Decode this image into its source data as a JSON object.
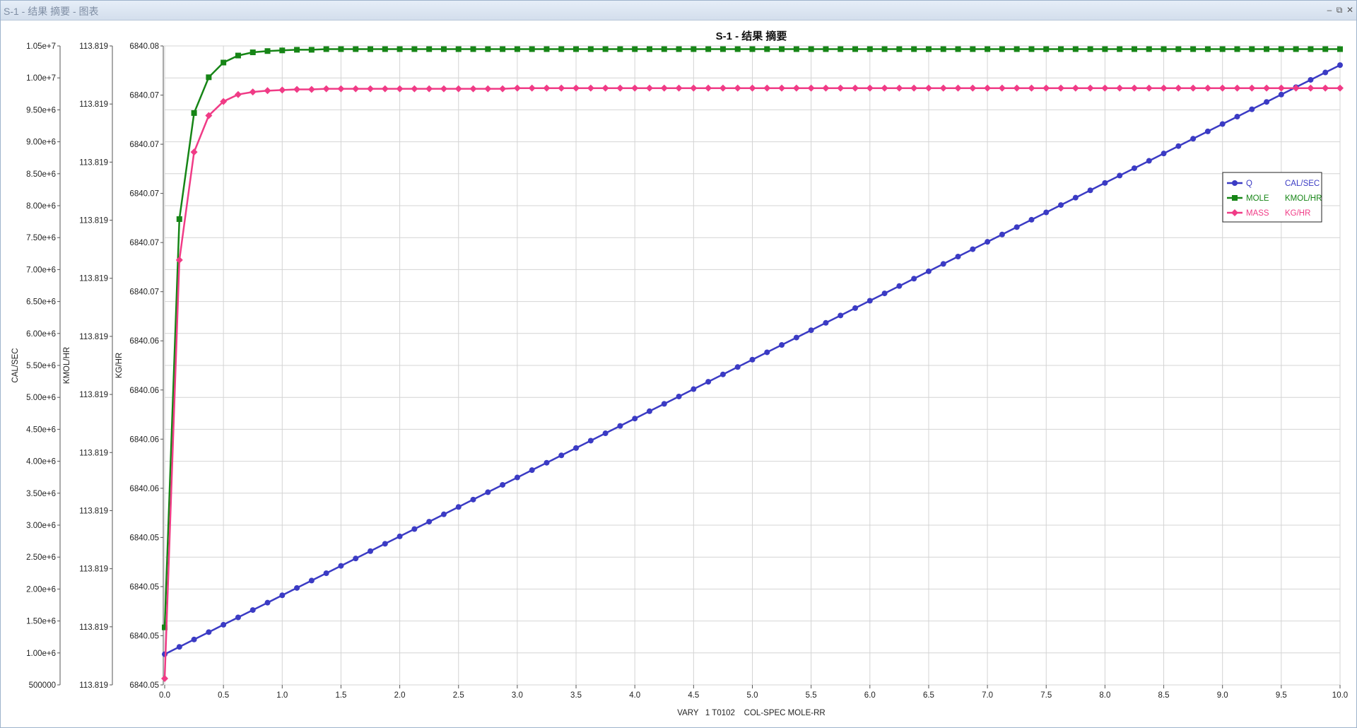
{
  "window": {
    "title": "S-1 - 结果 摘要 - 图表",
    "controls": [
      {
        "name": "minimize-icon",
        "glyph": "–"
      },
      {
        "name": "restore-icon",
        "glyph": "⧉"
      },
      {
        "name": "close-icon",
        "glyph": "✕"
      }
    ]
  },
  "chart_data": {
    "type": "line",
    "title": "S-1 - 结果 摘要",
    "xlabel": "VARY   1 T0102    COL-SPEC MOLE-RR",
    "xlim": [
      0,
      10
    ],
    "x_ticks": [
      "0.0",
      "0.5",
      "1.0",
      "1.5",
      "2.0",
      "2.5",
      "3.0",
      "3.5",
      "4.0",
      "4.5",
      "5.0",
      "5.5",
      "6.0",
      "6.5",
      "7.0",
      "7.5",
      "8.0",
      "8.5",
      "9.0",
      "9.5",
      "10.0"
    ],
    "grid": true,
    "legend_position": "right",
    "y_axes": [
      {
        "label": "CAL/SEC",
        "range": [
          500000,
          10500000
        ],
        "ticks": [
          "500000",
          "1.00e+6",
          "1.50e+6",
          "2.00e+6",
          "2.50e+6",
          "3.00e+6",
          "3.50e+6",
          "4.00e+6",
          "4.50e+6",
          "5.00e+6",
          "5.50e+6",
          "6.00e+6",
          "6.50e+6",
          "7.00e+6",
          "7.50e+6",
          "8.00e+6",
          "8.50e+6",
          "9.00e+6",
          "9.50e+6",
          "1.00e+7",
          "1.05e+7"
        ]
      },
      {
        "label": "KMOL/HR",
        "range": [
          0,
          1
        ],
        "ticks": [
          "113.819",
          "113.819",
          "113.819",
          "113.819",
          "113.819",
          "113.819",
          "113.819",
          "113.819",
          "113.819",
          "113.819",
          "113.819",
          "113.819"
        ]
      },
      {
        "label": "KG/HR",
        "range": [
          0,
          1
        ],
        "ticks": [
          "6840.05",
          "6840.05",
          "6840.05",
          "6840.05",
          "6840.06",
          "6840.06",
          "6840.06",
          "6840.06",
          "6840.07",
          "6840.07",
          "6840.07",
          "6840.07",
          "6840.07",
          "6840.08"
        ]
      }
    ],
    "series": [
      {
        "name": "Q",
        "unit": "CAL/SEC",
        "color": "#3b3bc4",
        "marker": "circle",
        "axis": 0,
        "x_start": 0.0,
        "x_step": 0.125,
        "y_start": 980000,
        "y_end": 10200000,
        "count": 81
      },
      {
        "name": "MOLE",
        "unit": "KMOL/HR",
        "color": "#168516",
        "marker": "square",
        "axis": 1,
        "x": [
          0.0,
          0.125,
          0.25,
          0.375,
          0.5,
          0.625,
          0.75,
          0.875,
          1.0,
          1.125,
          1.25,
          1.375,
          1.5,
          1.625,
          1.75,
          1.875,
          2.0,
          2.125,
          2.25,
          2.375,
          2.5,
          2.625,
          2.75,
          2.875,
          3.0,
          3.125,
          3.25,
          3.375,
          3.5,
          3.625,
          3.75,
          3.875,
          4.0,
          4.125,
          4.25,
          4.375,
          4.5,
          4.625,
          4.75,
          4.875,
          5.0,
          5.125,
          5.25,
          5.375,
          5.5,
          5.625,
          5.75,
          5.875,
          6.0,
          6.125,
          6.25,
          6.375,
          6.5,
          6.625,
          6.75,
          6.875,
          7.0,
          7.125,
          7.25,
          7.375,
          7.5,
          7.625,
          7.75,
          7.875,
          8.0,
          8.125,
          8.25,
          8.375,
          8.5,
          8.625,
          8.75,
          8.875,
          9.0,
          9.125,
          9.25,
          9.375,
          9.5,
          9.625,
          9.75,
          9.875,
          10.0
        ],
        "y": [
          0.09,
          0.729,
          0.895,
          0.951,
          0.974,
          0.985,
          0.99,
          0.992,
          0.993,
          0.994,
          0.994,
          0.995,
          0.995,
          0.995,
          0.995,
          0.995,
          0.995,
          0.995,
          0.995,
          0.995,
          0.995,
          0.995,
          0.995,
          0.995,
          0.995,
          0.995,
          0.995,
          0.995,
          0.995,
          0.995,
          0.995,
          0.995,
          0.995,
          0.995,
          0.995,
          0.995,
          0.995,
          0.995,
          0.995,
          0.995,
          0.995,
          0.995,
          0.995,
          0.995,
          0.995,
          0.995,
          0.995,
          0.995,
          0.995,
          0.995,
          0.995,
          0.995,
          0.995,
          0.995,
          0.995,
          0.995,
          0.995,
          0.995,
          0.995,
          0.995,
          0.995,
          0.995,
          0.995,
          0.995,
          0.995,
          0.995,
          0.995,
          0.995,
          0.995,
          0.995,
          0.995,
          0.995,
          0.995,
          0.995,
          0.995,
          0.995,
          0.995,
          0.995,
          0.995,
          0.995,
          0.995
        ]
      },
      {
        "name": "MASS",
        "unit": "KG/HR",
        "color": "#f03b86",
        "marker": "diamond",
        "axis": 2,
        "x": [
          0.0,
          0.125,
          0.25,
          0.375,
          0.5,
          0.625,
          0.75,
          0.875,
          1.0,
          1.125,
          1.25,
          1.375,
          1.5,
          1.625,
          1.75,
          1.875,
          2.0,
          2.125,
          2.25,
          2.375,
          2.5,
          2.625,
          2.75,
          2.875,
          3.0,
          3.125,
          3.25,
          3.375,
          3.5,
          3.625,
          3.75,
          3.875,
          4.0,
          4.125,
          4.25,
          4.375,
          4.5,
          4.625,
          4.75,
          4.875,
          5.0,
          5.125,
          5.25,
          5.375,
          5.5,
          5.625,
          5.75,
          5.875,
          6.0,
          6.125,
          6.25,
          6.375,
          6.5,
          6.625,
          6.75,
          6.875,
          7.0,
          7.125,
          7.25,
          7.375,
          7.5,
          7.625,
          7.75,
          7.875,
          8.0,
          8.125,
          8.25,
          8.375,
          8.5,
          8.625,
          8.75,
          8.875,
          9.0,
          9.125,
          9.25,
          9.375,
          9.5,
          9.625,
          9.75,
          9.875,
          10.0
        ],
        "y": [
          0.01,
          0.665,
          0.834,
          0.891,
          0.913,
          0.924,
          0.928,
          0.93,
          0.931,
          0.932,
          0.932,
          0.933,
          0.933,
          0.933,
          0.933,
          0.933,
          0.933,
          0.933,
          0.933,
          0.933,
          0.933,
          0.933,
          0.933,
          0.933,
          0.934,
          0.934,
          0.934,
          0.934,
          0.934,
          0.934,
          0.934,
          0.934,
          0.934,
          0.934,
          0.934,
          0.934,
          0.934,
          0.934,
          0.934,
          0.934,
          0.934,
          0.934,
          0.934,
          0.934,
          0.934,
          0.934,
          0.934,
          0.934,
          0.934,
          0.934,
          0.934,
          0.934,
          0.934,
          0.934,
          0.934,
          0.934,
          0.934,
          0.934,
          0.934,
          0.934,
          0.934,
          0.934,
          0.934,
          0.934,
          0.934,
          0.934,
          0.934,
          0.934,
          0.934,
          0.934,
          0.934,
          0.934,
          0.934,
          0.934,
          0.934,
          0.934,
          0.934,
          0.934,
          0.934,
          0.934,
          0.934
        ]
      }
    ]
  }
}
